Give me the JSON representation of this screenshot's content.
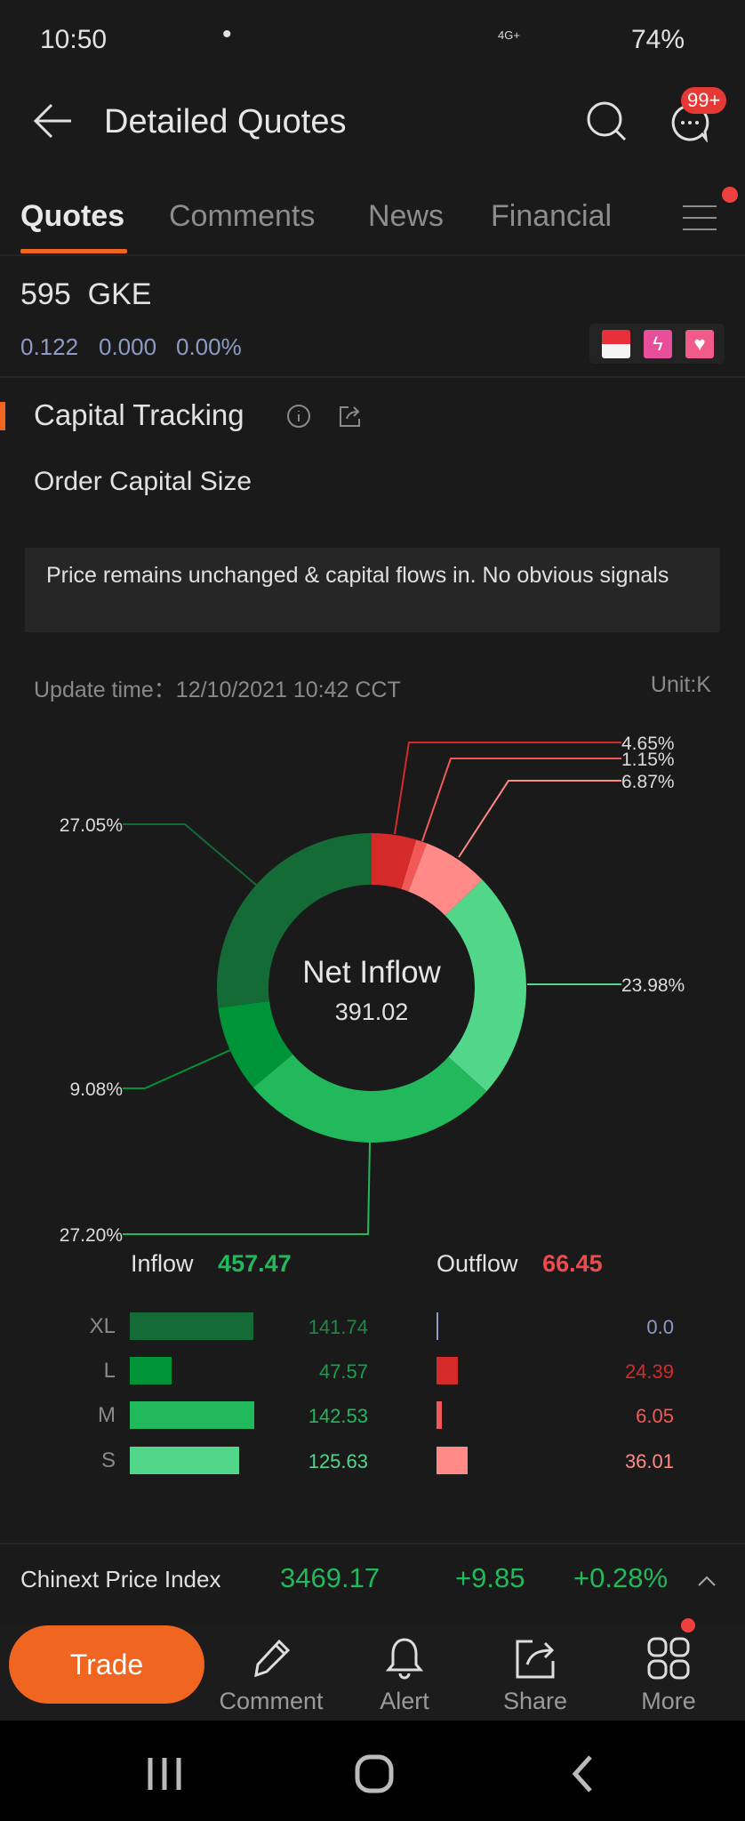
{
  "status_bar": {
    "time": "10:50",
    "battery": "74%",
    "network": "4G+"
  },
  "header": {
    "title": "Detailed Quotes",
    "notification_badge": "99+"
  },
  "tabs": [
    {
      "label": "Quotes",
      "active": true
    },
    {
      "label": "Comments"
    },
    {
      "label": "News"
    },
    {
      "label": "Financial"
    }
  ],
  "stock": {
    "code": "595",
    "name": "GKE",
    "price": "0.122",
    "change": "0.000",
    "change_pct": "0.00%"
  },
  "section": {
    "title": "Capital Tracking",
    "subtitle": "Order Capital Size",
    "signal": "Price remains unchanged & capital flows in. No obvious signals",
    "update_time": "Update time：12/10/2021 10:42 CCT",
    "unit": "Unit:K"
  },
  "chart_data": {
    "type": "pie",
    "center_label": "Net Inflow",
    "center_value": "391.02",
    "slices": [
      {
        "label": "4.65%",
        "value": 4.65,
        "color": "#d42a2a"
      },
      {
        "label": "1.15%",
        "value": 1.15,
        "color": "#f25858"
      },
      {
        "label": "6.87%",
        "value": 6.87,
        "color": "#ff8a87"
      },
      {
        "label": "23.98%",
        "value": 23.98,
        "color": "#52d689"
      },
      {
        "label": "27.20%",
        "value": 27.2,
        "color": "#22b95c"
      },
      {
        "label": "9.08%",
        "value": 9.08,
        "color": "#009438"
      },
      {
        "label": "27.05%",
        "value": 27.05,
        "color": "#146b36"
      }
    ]
  },
  "flows": {
    "inflow_label": "Inflow",
    "inflow_total": "457.47",
    "outflow_label": "Outflow",
    "outflow_total": "66.45",
    "rows": [
      {
        "size": "XL",
        "inflow": 141.74,
        "inflow_text": "141.74",
        "inflow_color": "#146b36",
        "outflow": 0.0,
        "outflow_text": "0.0",
        "outflow_color": "#8e9bc4",
        "in_text_color": "#1e8a45"
      },
      {
        "size": "L",
        "inflow": 47.57,
        "inflow_text": "47.57",
        "inflow_color": "#009438",
        "outflow": 24.39,
        "outflow_text": "24.39",
        "outflow_color": "#d42a2a",
        "in_text_color": "#14a24a"
      },
      {
        "size": "M",
        "inflow": 142.53,
        "inflow_text": "142.53",
        "inflow_color": "#22b95c",
        "outflow": 6.05,
        "outflow_text": "6.05",
        "outflow_color": "#f25858",
        "in_text_color": "#22b95c"
      },
      {
        "size": "S",
        "inflow": 125.63,
        "inflow_text": "125.63",
        "inflow_color": "#52d689",
        "outflow": 36.01,
        "outflow_text": "36.01",
        "outflow_color": "#ff8a87",
        "in_text_color": "#52d689"
      }
    ]
  },
  "index_bar": {
    "name": "Chinext Price Index",
    "value": "3469.17",
    "change": "+9.85",
    "change_pct": "+0.28%"
  },
  "toolbar": {
    "trade": "Trade",
    "comment": "Comment",
    "alert": "Alert",
    "share": "Share",
    "more": "More"
  }
}
